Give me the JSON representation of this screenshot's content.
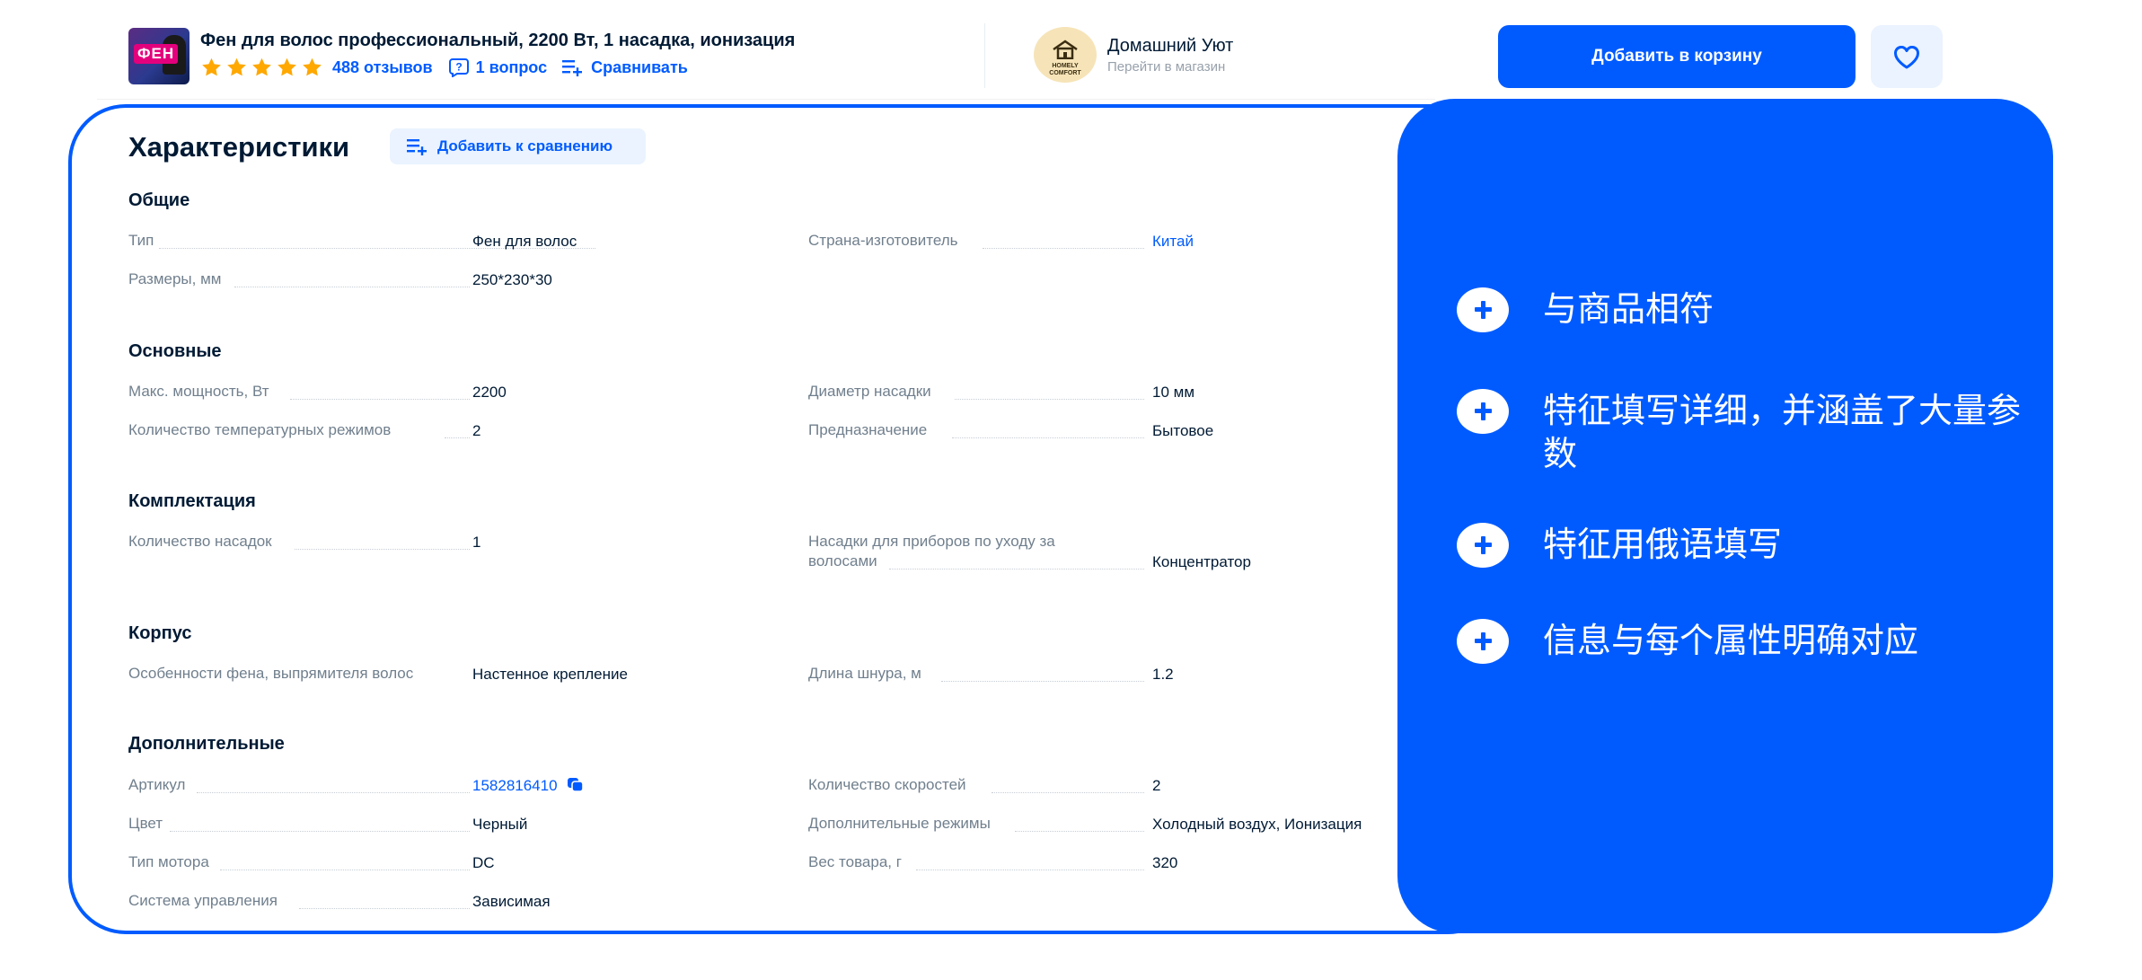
{
  "product": {
    "thumb_text": "ФЕН",
    "title": "Фен для волос профессиональный, 2200 Вт, 1 насадка, ионизация",
    "rating_stars": 5,
    "reviews": "488 отзывов",
    "questions": "1 вопрос",
    "compare": "Сравнивать"
  },
  "store": {
    "logo_text_1": "HOMELY",
    "logo_text_2": "COMFORT",
    "name": "Домашний Уют",
    "sub": "Перейти в магазин"
  },
  "actions": {
    "cart": "Добавить в корзину"
  },
  "specs": {
    "title": "Характеристики",
    "add_compare": "Добавить к сравнению",
    "sections": {
      "general": {
        "title": "Общие",
        "type_label": "Тип",
        "type_value": "Фен для волос",
        "country_label": "Страна-изготовитель",
        "country_value": "Китай",
        "size_label": "Размеры, мм",
        "size_value": "250*230*30"
      },
      "main": {
        "title": "Основные",
        "power_label": "Макс. мощность, Вт",
        "power_value": "2200",
        "diam_label": "Диаметр насадки",
        "diam_value": "10 мм",
        "temp_label": "Количество температурных режимов",
        "temp_value": "2",
        "purpose_label": "Предназначение",
        "purpose_value": "Бытовое"
      },
      "kit": {
        "title": "Комплектация",
        "count_label": "Количество насадок",
        "count_value": "1",
        "attach_label": "Насадки для приборов по уходу за волосами",
        "attach_value": "Концентратор"
      },
      "body": {
        "title": "Корпус",
        "feature_label": "Особенности фена, выпрямителя волос",
        "feature_value": "Настенное крепление",
        "cord_label": "Длина шнура, м",
        "cord_value": "1.2"
      },
      "extra": {
        "title": "Дополнительные",
        "sku_label": "Артикул",
        "sku_value": "1582816410",
        "speeds_label": "Количество скоростей",
        "speeds_value": "2",
        "color_label": "Цвет",
        "color_value": "Черный",
        "modes_label": "Дополнительные режимы",
        "modes_value": "Холодный воздух, Ионизация",
        "motor_label": "Тип мотора",
        "motor_value": "DC",
        "weight_label": "Вес товара, г",
        "weight_value": "320",
        "control_label": "Система управления",
        "control_value": "Зависимая"
      }
    }
  },
  "callout": {
    "points": [
      "与商品相符",
      "特征填写详细，并涵盖了大量参数",
      "特征用俄语填写",
      "信息与每个属性明确对应"
    ]
  },
  "colors": {
    "accent": "#005bff",
    "star": "#ffa800",
    "text": "#001a34",
    "muted": "#707f8d"
  }
}
